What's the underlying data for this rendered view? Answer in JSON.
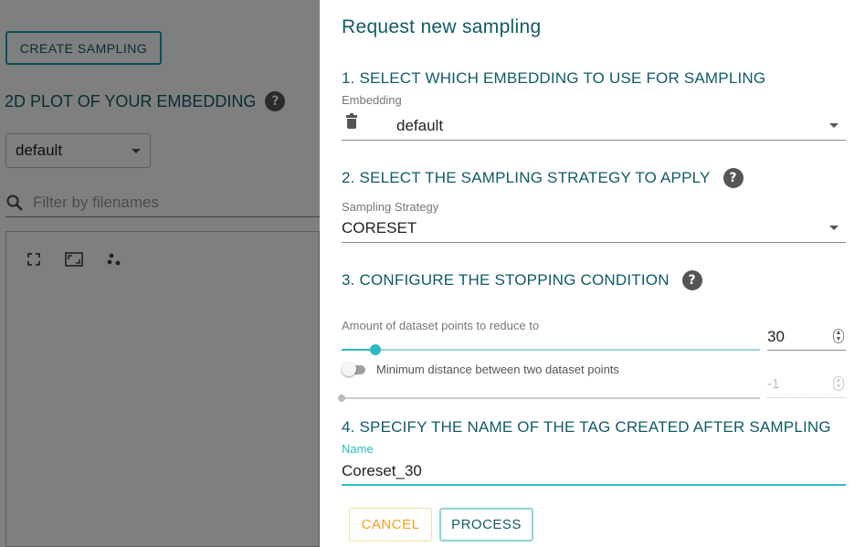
{
  "background": {
    "create_button": "CREATE SAMPLING",
    "plot_title": "2D PLOT OF YOUR EMBEDDING",
    "help_glyph": "?",
    "embedding_select": "default",
    "search_placeholder": "Filter by filenames",
    "plot_tools": [
      "fullscreen-icon",
      "aspect-ratio-icon",
      "scatter-icon"
    ]
  },
  "dialog": {
    "title": "Request new sampling",
    "section1": {
      "title": "1. SELECT WHICH EMBEDDING TO USE FOR SAMPLING",
      "label": "Embedding",
      "value": "default"
    },
    "section2": {
      "title": "2. SELECT THE SAMPLING STRATEGY TO APPLY",
      "label": "Sampling Strategy",
      "value": "CORESET"
    },
    "section3": {
      "title": "3. CONFIGURE THE STOPPING CONDITION",
      "amount_label": "Amount of dataset points to reduce to",
      "amount_value": "30",
      "amount_fraction": 0.08,
      "min_distance_label": "Minimum distance between two dataset points",
      "min_distance_value": "-1",
      "min_distance_enabled": false
    },
    "section4": {
      "title": "4. SPECIFY THE NAME OF THE TAG CREATED AFTER SAMPLING",
      "label": "Name",
      "value": "Coreset_30"
    },
    "buttons": {
      "cancel": "CANCEL",
      "process": "PROCESS"
    }
  },
  "colors": {
    "primary_text": "#0f5a68",
    "accent": "#2bbac4",
    "cancel": "#f0a320"
  }
}
